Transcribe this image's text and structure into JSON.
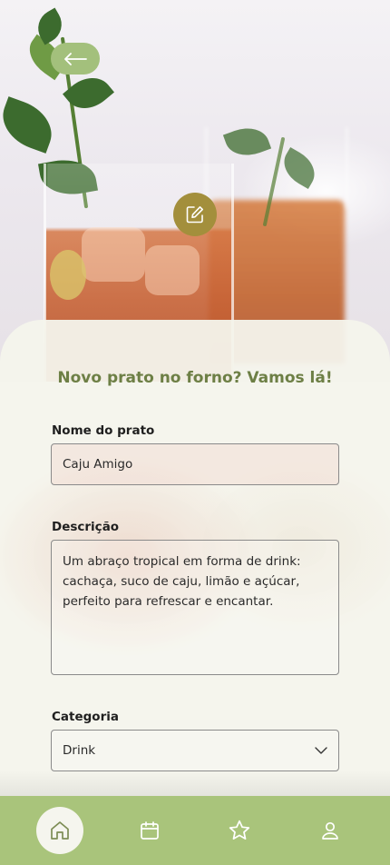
{
  "hero": {
    "image": "cocktail-photo",
    "back_icon": "arrow-left-icon",
    "edit_icon": "edit-pencil-icon"
  },
  "form": {
    "title": "Novo prato no forno? Vamos lá!",
    "name": {
      "label": "Nome do prato",
      "value": "Caju Amigo"
    },
    "description": {
      "label": "Descrição",
      "value": "Um abraço tropical em forma de drink: cachaça, suco de caju, limão e açúcar, perfeito para refrescar e encantar."
    },
    "category": {
      "label": "Categoria",
      "value": "Drink",
      "icon": "chevron-down-icon"
    }
  },
  "nav": {
    "items": [
      {
        "icon": "home-icon",
        "active": true
      },
      {
        "icon": "calendar-icon",
        "active": false
      },
      {
        "icon": "star-icon",
        "active": false
      },
      {
        "icon": "user-icon",
        "active": false
      }
    ]
  },
  "colors": {
    "accent_green": "#a9c47b",
    "title_green": "#6d7f45",
    "edit_gold": "#a38f3c"
  }
}
